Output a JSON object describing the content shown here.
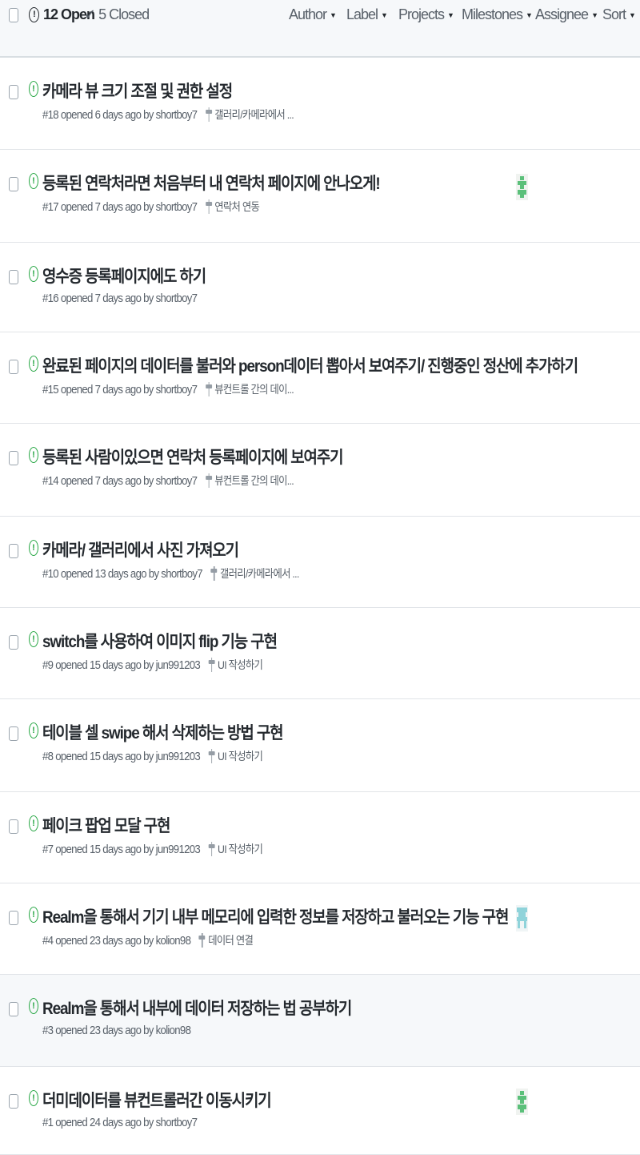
{
  "header": {
    "open_label": "12 Open",
    "closed_label": "5 Closed",
    "check_glyph": "✓",
    "open_glyph": "!",
    "filters": [
      "Author",
      "Label",
      "Projects",
      "Milestones",
      "Assignee",
      "Sort"
    ]
  },
  "status_glyph": "!",
  "colors": {
    "open_green": "#28a745",
    "avatar_green": "#5bc07a",
    "avatar_teal": "#8fd3da"
  },
  "issues": [
    {
      "title": "카메라 뷰 크기 조절 및 권한 설정",
      "meta": "#18 opened 6 days ago by shortboy7",
      "milestone": "갤러리/카메라에서 ..."
    },
    {
      "title": "등록된 연락처라면 처음부터 내 연락처 페이지에 안나오게!",
      "meta": "#17 opened 7 days ago by shortboy7",
      "milestone": "연락처 연동",
      "avatar": "green"
    },
    {
      "title": "영수증 등록페이지에도 하기",
      "meta": "#16 opened 7 days ago by shortboy7",
      "milestone": ""
    },
    {
      "title": "완료된 페이지의 데이터를 불러와 person데이터 뽑아서 보여주기/ 진행중인 정산에 추가하기",
      "meta": "#15 opened 7 days ago by shortboy7",
      "milestone": "뷰컨트롤 간의 데이..."
    },
    {
      "title": "등록된 사람이있으면 연락처 등록페이지에 보여주기",
      "meta": "#14 opened 7 days ago by shortboy7",
      "milestone": "뷰컨트롤 간의 데이..."
    },
    {
      "title": "카메라/ 갤러리에서 사진 가져오기",
      "meta": "#10 opened 13 days ago by shortboy7",
      "milestone": "갤러리/카메라에서 ..."
    },
    {
      "title": "switch를 사용하여 이미지 flip 기능 구현",
      "meta": "#9 opened 15 days ago by jun991203",
      "milestone": "UI 작성하기"
    },
    {
      "title": "테이블 셀 swipe 해서 삭제하는 방법 구현",
      "meta": "#8 opened 15 days ago by jun991203",
      "milestone": "UI 작성하기"
    },
    {
      "title": "페이크 팝업 모달 구현",
      "meta": "#7 opened 15 days ago by jun991203",
      "milestone": "UI 작성하기"
    },
    {
      "title": "Realm을 통해서 기기 내부 메모리에 입력한 정보를 저장하고 불러오는 기능 구현",
      "meta": "#4 opened 23 days ago by kolion98",
      "milestone": "데이터 연결",
      "avatar": "teal"
    },
    {
      "title": "Realm을 통해서 내부에 데이터 저장하는 법 공부하기",
      "meta": "#3 opened 23 days ago by kolion98",
      "milestone": "",
      "highlight": true
    },
    {
      "title": "더미데이터를 뷰컨트롤러간 이동시키기",
      "meta": "#1 opened 24 days ago by shortboy7",
      "milestone": "",
      "avatar": "green"
    }
  ]
}
